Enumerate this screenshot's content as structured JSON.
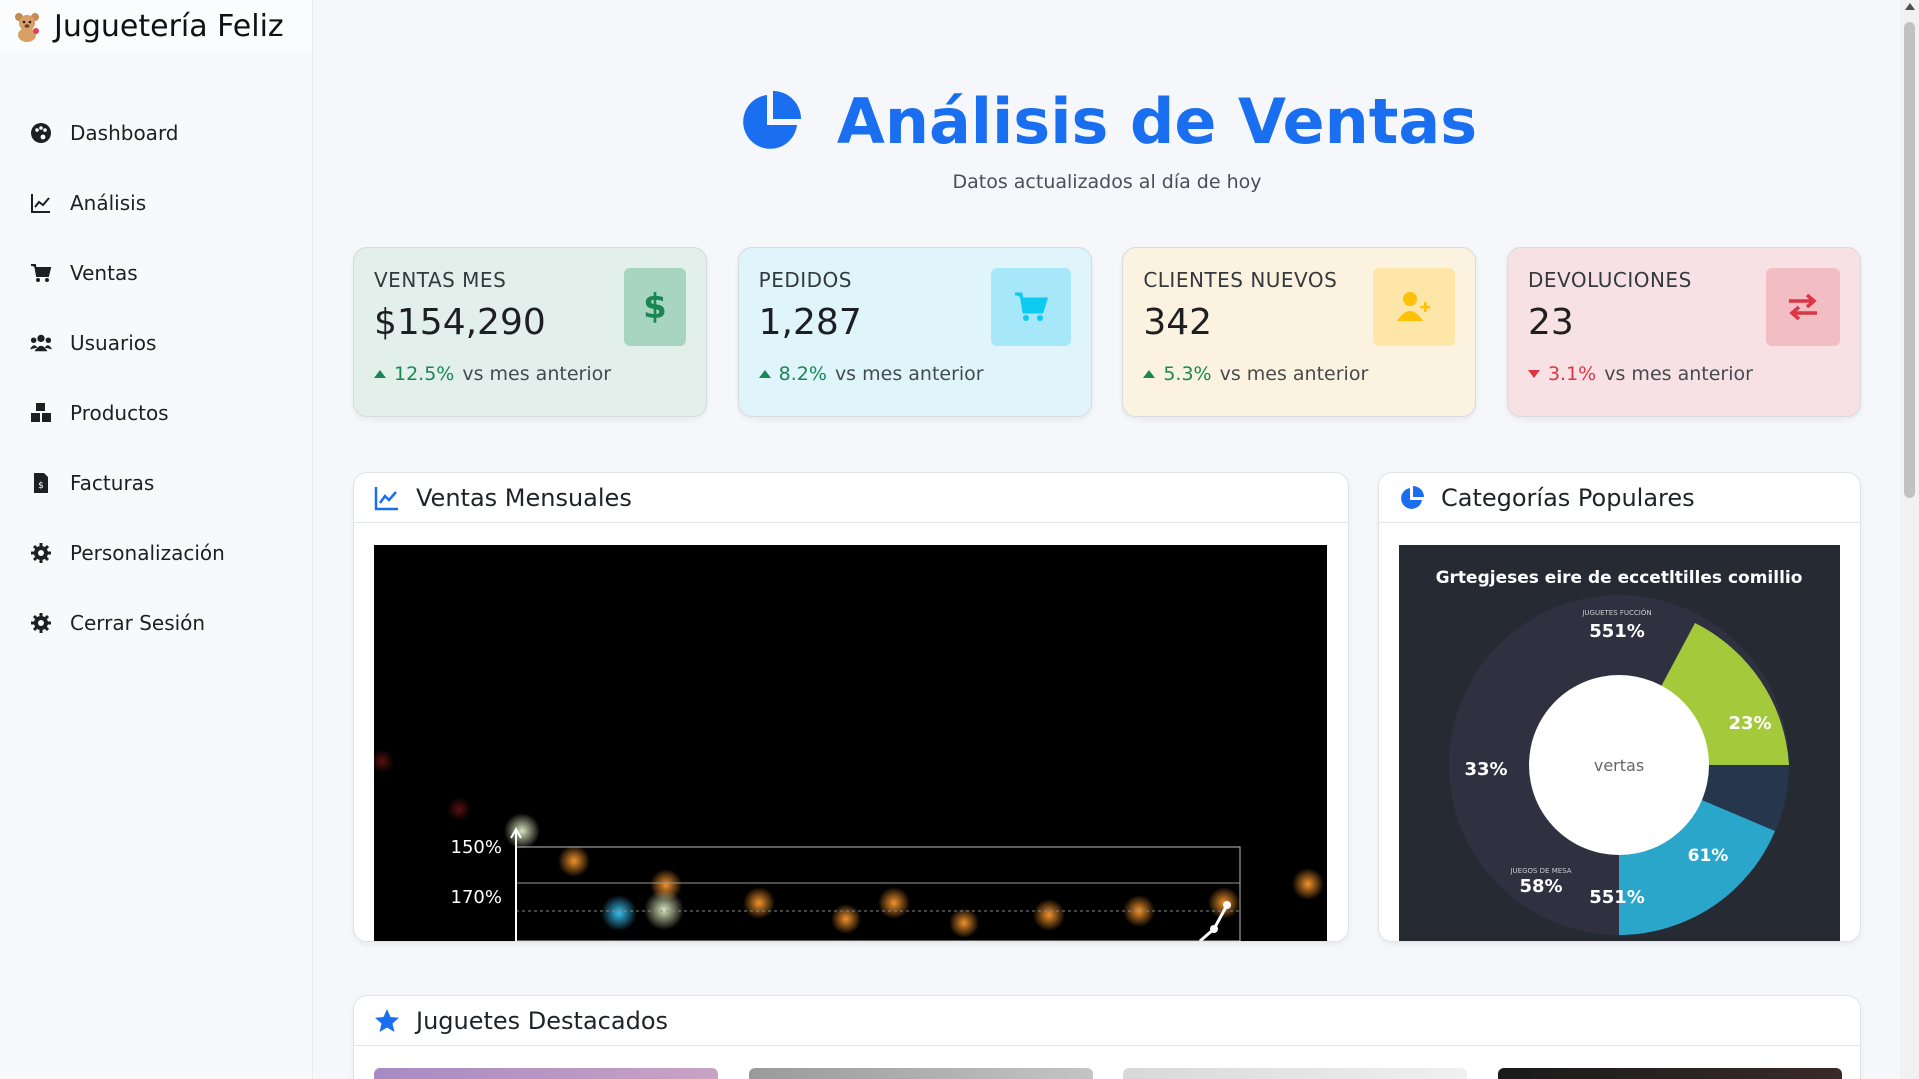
{
  "brand": {
    "name": "Juguetería Feliz",
    "logo": "teddy-bear-icon"
  },
  "sidebar": {
    "items": [
      {
        "label": "Dashboard",
        "icon": "palette-icon"
      },
      {
        "label": "Análisis",
        "icon": "line-chart-icon"
      },
      {
        "label": "Ventas",
        "icon": "cart-icon"
      },
      {
        "label": "Usuarios",
        "icon": "users-icon"
      },
      {
        "label": "Productos",
        "icon": "boxes-icon"
      },
      {
        "label": "Facturas",
        "icon": "invoice-icon"
      },
      {
        "label": "Personalización",
        "icon": "gear-icon"
      },
      {
        "label": "Cerrar Sesión",
        "icon": "gear-icon"
      }
    ]
  },
  "header": {
    "title": "Análisis de Ventas",
    "subtitle": "Datos actualizados al día de hoy",
    "accent": "#1a6ff0"
  },
  "stats": [
    {
      "label": "VENTAS MES",
      "value": "$154,290",
      "change": "12.5%",
      "direction": "up",
      "note": "vs mes anterior",
      "icon": "dollar-icon",
      "color": "#198754"
    },
    {
      "label": "PEDIDOS",
      "value": "1,287",
      "change": "8.2%",
      "direction": "up",
      "note": "vs mes anterior",
      "icon": "cart-icon",
      "color": "#0dcaf0"
    },
    {
      "label": "CLIENTES NUEVOS",
      "value": "342",
      "change": "5.3%",
      "direction": "up",
      "note": "vs mes anterior",
      "icon": "user-plus-icon",
      "color": "#ffc107"
    },
    {
      "label": "DEVOLUCIONES",
      "value": "23",
      "change": "3.1%",
      "direction": "down",
      "note": "vs mes anterior",
      "icon": "exchange-icon",
      "color": "#dc3545"
    }
  ],
  "cards": {
    "ventas": {
      "title": "Ventas Mensuales",
      "icon": "line-chart-icon"
    },
    "categorias": {
      "title": "Categorías Populares",
      "icon": "pie-chart-icon"
    },
    "juguetes": {
      "title": "Juguetes Destacados",
      "icon": "star-icon"
    }
  },
  "line_chart_labels": {
    "y1": "150%",
    "y2": "170%"
  },
  "pie_chart": {
    "title": "Grtegjeses eire de eccetltilles comillio",
    "center": "vertas",
    "labels": [
      {
        "small": "JUGUETES FUCCIÓN",
        "big": "551%"
      },
      {
        "small": "",
        "big": "23%"
      },
      {
        "small": "",
        "big": "33%"
      },
      {
        "small": "",
        "big": "61%"
      },
      {
        "small": "JUEGOS DE MESA",
        "big": "58%"
      },
      {
        "small": "",
        "big": "551%"
      }
    ]
  }
}
